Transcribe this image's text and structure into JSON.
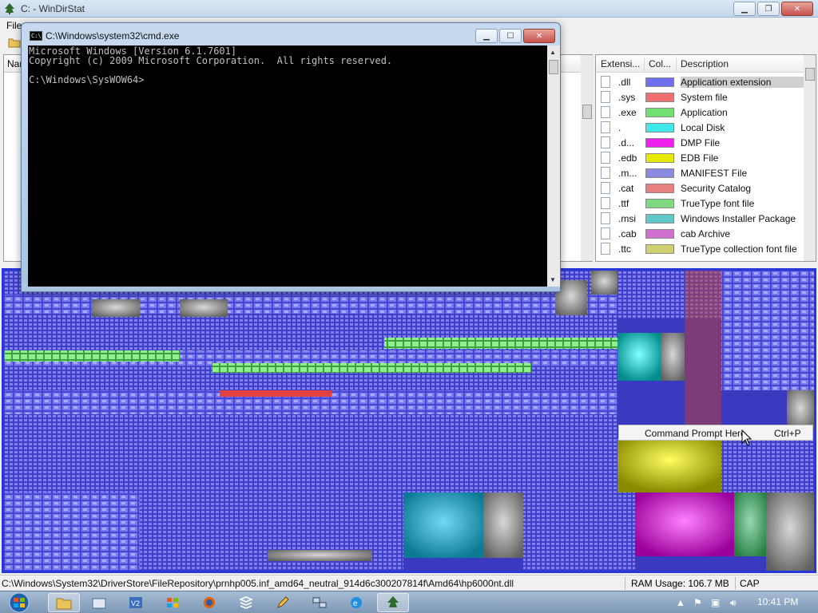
{
  "windirstat": {
    "title": "C: - WinDirStat",
    "menu_first": "File",
    "tree_header": "Name",
    "ext_columns": [
      "Extensi...",
      "Col...",
      "Description"
    ],
    "extensions": [
      {
        "ext": ".dll",
        "color": "#6f6ff0",
        "desc": "Application extension",
        "selected": true
      },
      {
        "ext": ".sys",
        "color": "#f07070",
        "desc": "System file"
      },
      {
        "ext": ".exe",
        "color": "#70e070",
        "desc": "Application"
      },
      {
        "ext": ".",
        "color": "#40e8e8",
        "desc": "Local Disk"
      },
      {
        "ext": ".d...",
        "color": "#ee20ee",
        "desc": "DMP File"
      },
      {
        "ext": ".edb",
        "color": "#e8e800",
        "desc": "EDB File"
      },
      {
        "ext": ".m...",
        "color": "#8a8ae0",
        "desc": "MANIFEST File"
      },
      {
        "ext": ".cat",
        "color": "#e88080",
        "desc": "Security Catalog"
      },
      {
        "ext": ".ttf",
        "color": "#80d880",
        "desc": "TrueType font file"
      },
      {
        "ext": ".msi",
        "color": "#60c8c8",
        "desc": "Windows Installer Package"
      },
      {
        "ext": ".cab",
        "color": "#d070d0",
        "desc": "cab Archive"
      },
      {
        "ext": ".ttc",
        "color": "#d0d070",
        "desc": "TrueType collection font file"
      }
    ],
    "context_menu": {
      "label": "Command Prompt Here",
      "shortcut": "Ctrl+P"
    },
    "status": {
      "path": "C:\\Windows\\System32\\DriverStore\\FileRepository\\prnhp005.inf_amd64_neutral_914d6c300207814f\\Amd64\\hp6000nt.dll",
      "ram_label": "RAM Usage:",
      "ram_value": "106.7 MB",
      "caps": "CAP"
    }
  },
  "cmd": {
    "title": "C:\\Windows\\system32\\cmd.exe",
    "icon_text": "C:\\",
    "lines": [
      "Microsoft Windows [Version 6.1.7601]",
      "Copyright (c) 2009 Microsoft Corporation.  All rights reserved.",
      "",
      "C:\\Windows\\SysWOW64>"
    ]
  },
  "taskbar": {
    "apps": [
      "explorer",
      "folder",
      "vmware",
      "windows",
      "firefox",
      "stack",
      "pencil",
      "network",
      "ie",
      "windirstat"
    ],
    "clock": "10:41 PM"
  },
  "colors": {
    "treemap_border": "#2838d8",
    "treemap_blue": "#5050e0",
    "cmd_text": "#c0c0c0"
  }
}
